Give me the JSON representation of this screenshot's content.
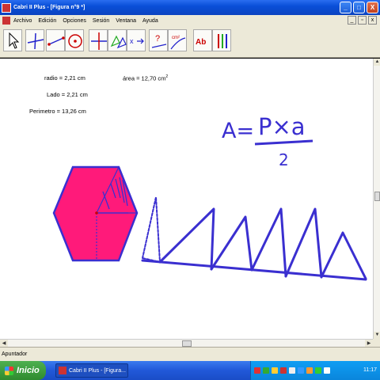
{
  "window": {
    "title": "Cabri II Plus - [Figura n°9 *]",
    "buttons": {
      "minimize": "_",
      "maximize": "□",
      "close": "X"
    }
  },
  "menubar": {
    "items": [
      "Archivo",
      "Edición",
      "Opciones",
      "Sesión",
      "Ventana",
      "Ayuda"
    ]
  },
  "toolbar": {
    "tools": [
      "pointer",
      "lines",
      "segment",
      "circle",
      "perpendicular",
      "transform",
      "macro",
      "check-property",
      "measure",
      "text",
      "display"
    ],
    "measure_tool_glyph": "cm²",
    "text_tool_glyph": "Ab"
  },
  "canvas": {
    "measurements": {
      "radio": "radio = 2,21 cm",
      "lado": "Lado = 2,21 cm",
      "perimetro": "Perimetro = 13,26 cm",
      "area_label": "área = 12,70 cm",
      "area_exponent": "2"
    },
    "handwriting": {
      "lhs": "A=",
      "numerator": "P×a",
      "denominator": "2"
    },
    "colors": {
      "hexagon_fill": "#ff1a7a",
      "ink": "#3a2fd0"
    }
  },
  "statusbar": {
    "text": "Apuntador"
  },
  "taskbar": {
    "start_label": "Inicio",
    "task_label": "Cabri II Plus - [Figura...",
    "clock": "11:17"
  }
}
